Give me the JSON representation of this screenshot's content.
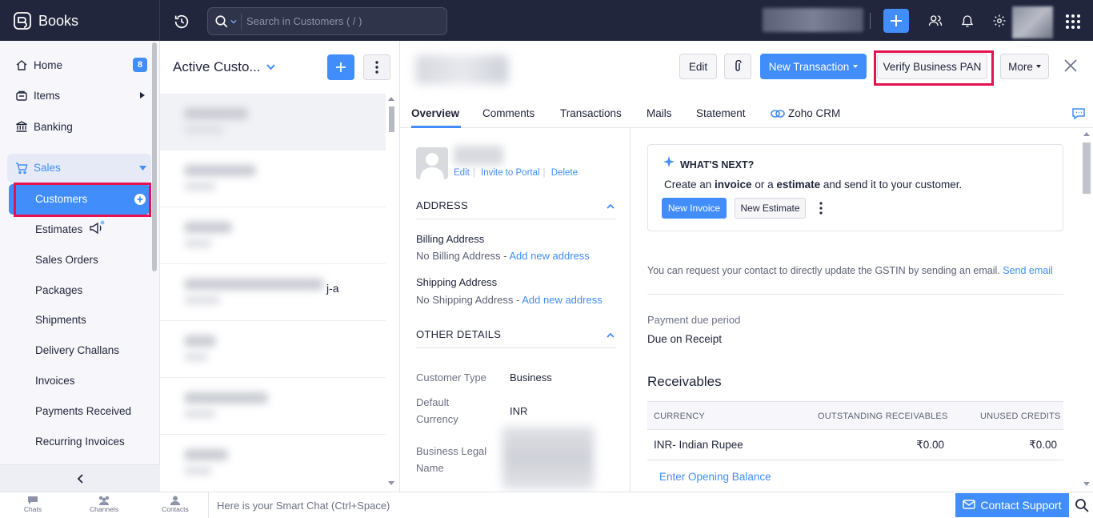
{
  "app": {
    "name": "Books"
  },
  "search": {
    "placeholder": "Search in Customers ( / )"
  },
  "sidebar": {
    "home": "Home",
    "home_badge": "8",
    "items": "Items",
    "banking": "Banking",
    "sales": "Sales",
    "customers": "Customers",
    "sub": [
      "Estimates",
      "Sales Orders",
      "Packages",
      "Shipments",
      "Delivery Challans",
      "Invoices",
      "Payments Received",
      "Recurring Invoices"
    ]
  },
  "list": {
    "title": "Active Custo...",
    "row_tail": "j-a"
  },
  "detail": {
    "edit": "Edit",
    "new_transaction": "New Transaction",
    "verify_pan": "Verify Business PAN",
    "more": "More",
    "tabs": [
      "Overview",
      "Comments",
      "Transactions",
      "Mails",
      "Statement",
      "Zoho CRM"
    ],
    "contact_links": {
      "edit": "Edit",
      "invite": "Invite to Portal",
      "delete": "Delete"
    },
    "address": {
      "heading": "ADDRESS",
      "billing_label": "Billing Address",
      "billing_none": "No Billing Address - ",
      "billing_add": "Add new address",
      "shipping_label": "Shipping Address",
      "shipping_none": "No Shipping Address - ",
      "shipping_add": "Add new address"
    },
    "other": {
      "heading": "OTHER DETAILS",
      "type_label": "Customer Type",
      "type_value": "Business",
      "currency_label": "Default Currency",
      "currency_value": "INR",
      "legal_label": "Business Legal Name"
    },
    "whats_next": {
      "title": "WHAT'S NEXT?",
      "text_1": "Create an ",
      "text_b1": "invoice",
      "text_2": " or a ",
      "text_b2": "estimate",
      "text_3": " and send it to your customer.",
      "new_invoice": "New Invoice",
      "new_estimate": "New Estimate"
    },
    "gstin_text": "You can request your contact to directly update the GSTIN by sending an email.",
    "send_email": "Send email",
    "payment_due_label": "Payment due period",
    "payment_due_value": "Due on Receipt",
    "receivables": {
      "title": "Receivables",
      "headers": [
        "CURRENCY",
        "OUTSTANDING RECEIVABLES",
        "UNUSED CREDITS"
      ],
      "row": [
        "INR- Indian Rupee",
        "₹0.00",
        "₹0.00"
      ],
      "opening": "Enter Opening Balance"
    }
  },
  "bottom": {
    "chats": "Chats",
    "channels": "Channels",
    "contacts": "Contacts",
    "smartchat_placeholder": "Here is your Smart Chat (Ctrl+Space)",
    "support": "Contact Support"
  },
  "colors": {
    "accent": "#408dfb",
    "topbar": "#21263c",
    "highlight": "#e8114f"
  }
}
